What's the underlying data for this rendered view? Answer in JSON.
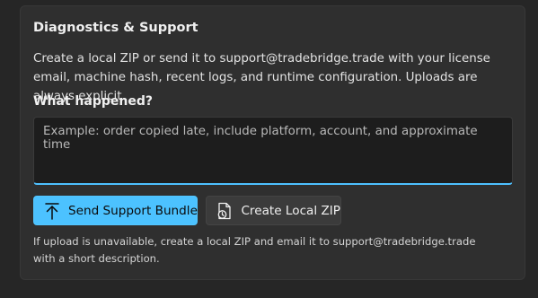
{
  "section": {
    "title": "Diagnostics & Support",
    "description": "Create a local ZIP or send it to support@tradebridge.trade with your license email, machine hash, recent logs, and runtime configuration. Uploads are always explicit."
  },
  "form": {
    "label": "What happened?",
    "placeholder": "Example: order copied late, include platform, account, and approximate time",
    "value": ""
  },
  "buttons": {
    "send_label": "Send Support Bundle",
    "send_icon": "upload-icon",
    "zip_label": "Create Local ZIP",
    "zip_icon": "zip-file-icon"
  },
  "footnote": "If upload is unavailable, create a local ZIP and email it to support@tradebridge.trade with a short description.",
  "colors": {
    "accent": "#4cc2ff",
    "background": "#262626",
    "panel": "#2f2f2f"
  }
}
